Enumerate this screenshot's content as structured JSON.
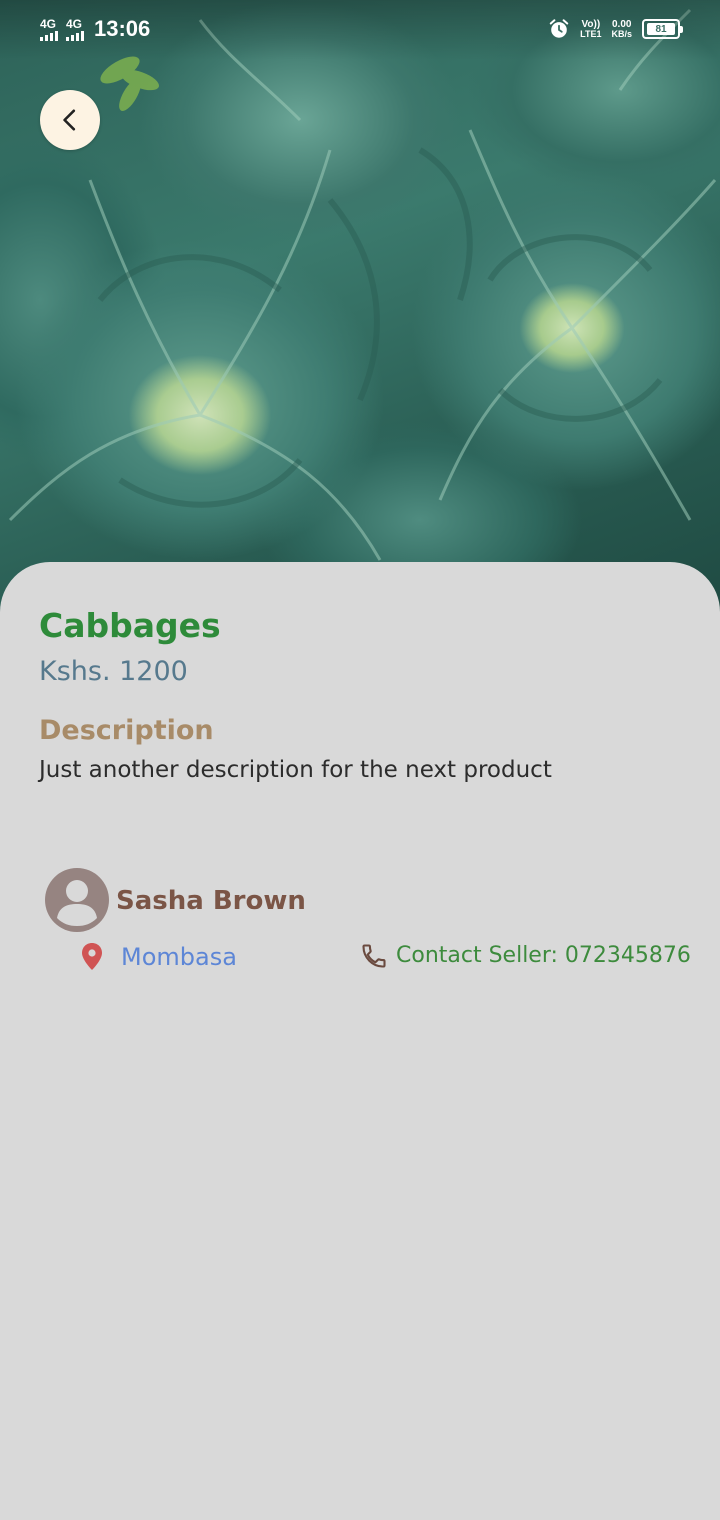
{
  "status_bar": {
    "network_1": "4G",
    "network_2": "4G",
    "time": "13:06",
    "volte": "Vo))",
    "lte": "LTE1",
    "speed_value": "0.00",
    "speed_unit": "KB/s",
    "battery": "81"
  },
  "product": {
    "name": "Cabbages",
    "price": "Kshs. 1200",
    "description_heading": "Description",
    "description": "Just another description for the next product"
  },
  "seller": {
    "name": "Sasha Brown",
    "location": "Mombasa",
    "contact": "Contact Seller: 072345876"
  },
  "icons": {
    "back": "chevron-left-icon",
    "avatar": "person-icon",
    "location": "location-pin-icon",
    "phone": "phone-icon",
    "alarm": "alarm-clock-icon"
  },
  "colors": {
    "background": "#d9d9d9",
    "product_name": "#2e8b3a",
    "price": "#56798d",
    "description_heading": "#a88b68",
    "seller_name": "#7b5546",
    "location_text": "#5d86d6",
    "location_icon": "#d05454",
    "contact_text": "#3d8b3d",
    "back_button_bg": "#fdf3e3"
  }
}
